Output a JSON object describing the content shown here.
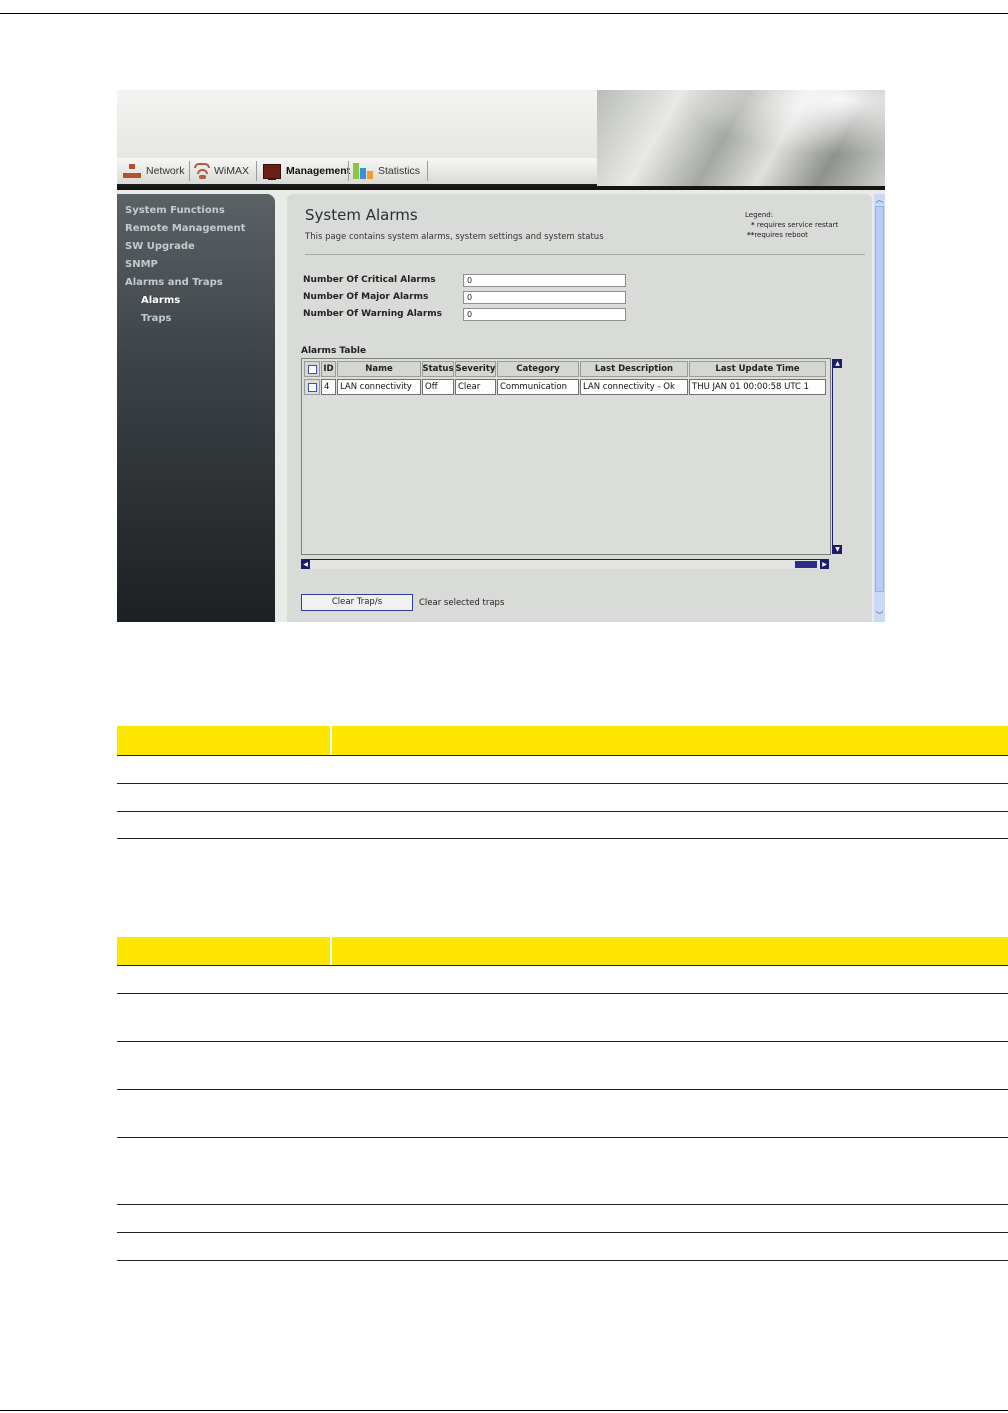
{
  "nav": {
    "tabs": [
      {
        "label": "Network"
      },
      {
        "label": "WiMAX"
      },
      {
        "label": "Management"
      },
      {
        "label": "Statistics"
      }
    ]
  },
  "sidebar": {
    "items": [
      {
        "label": "System Functions"
      },
      {
        "label": "Remote Management"
      },
      {
        "label": "SW Upgrade"
      },
      {
        "label": "SNMP"
      },
      {
        "label": "Alarms and Traps"
      },
      {
        "label": "Alarms"
      },
      {
        "label": "Traps"
      }
    ]
  },
  "page": {
    "title": "System Alarms",
    "description": "This page contains system alarms, system settings and system status"
  },
  "legend": {
    "title": "Legend:",
    "restart": "requires service restart",
    "reboot": "requires reboot"
  },
  "counters": [
    {
      "label": "Number Of Critical Alarms",
      "value": "0"
    },
    {
      "label": "Number Of Major Alarms",
      "value": "0"
    },
    {
      "label": "Number Of Warning Alarms",
      "value": "0"
    }
  ],
  "alarms_table": {
    "title": "Alarms Table",
    "columns": [
      "ID",
      "Name",
      "Status",
      "Severity",
      "Category",
      "Last Description",
      "Last Update Time"
    ],
    "rows": [
      {
        "id": "4",
        "name": "LAN connectivity",
        "status": "Off",
        "severity": "Clear",
        "category": "Communication",
        "last_description": "LAN connectivity - Ok",
        "last_update_time": "THU JAN 01 00:00:58 UTC 1"
      }
    ]
  },
  "actions": {
    "clear_button": "Clear Trap/s",
    "clear_note": "Clear selected traps"
  },
  "colors": {
    "header_yellow": "#ffe600",
    "sidebar_dark": "#1d2023",
    "scroll_navy": "#1b1c6e"
  }
}
